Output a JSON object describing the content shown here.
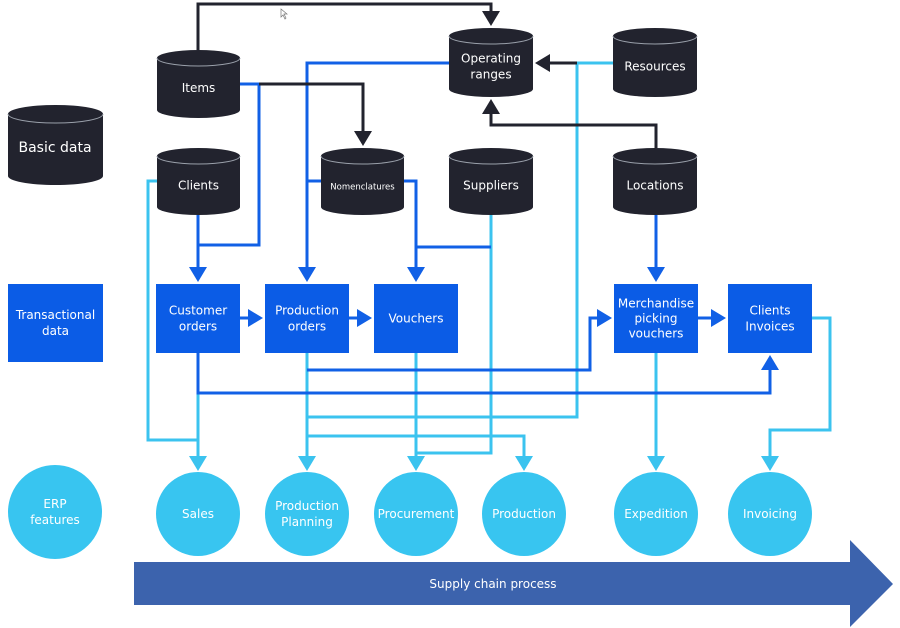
{
  "colors": {
    "cylinder": "#22232e",
    "transaction_box": "#0b5ce6",
    "feature_circle": "#38c5f0",
    "process_arrow": "#3c63ad",
    "dark_link": "#22232e",
    "blue_link": "#1160e6",
    "light_link": "#3bc3ef"
  },
  "rows": {
    "basic_data": "Basic data",
    "transactional_data": [
      "Transactional",
      "data"
    ],
    "erp_features": [
      "ERP",
      "features"
    ]
  },
  "basic_data": {
    "items": [
      "Items"
    ],
    "operating_ranges": [
      "Operating",
      "ranges"
    ],
    "resources": [
      "Resources"
    ],
    "clients": [
      "Clients"
    ],
    "nomenclatures": [
      "Nomenclatures"
    ],
    "suppliers": [
      "Suppliers"
    ],
    "locations": [
      "Locations"
    ]
  },
  "transactional_data": {
    "customer_orders": [
      "Customer",
      "orders"
    ],
    "production_orders": [
      "Production",
      "orders"
    ],
    "vouchers": [
      "Vouchers"
    ],
    "merchandise_picking_vouchers": [
      "Merchandise",
      "picking",
      "vouchers"
    ],
    "clients_invoices": [
      "Clients",
      "Invoices"
    ]
  },
  "erp_features": {
    "sales": [
      "Sales"
    ],
    "production_planning": [
      "Production",
      "Planning"
    ],
    "procurement": [
      "Procurement"
    ],
    "production": [
      "Production"
    ],
    "expedition": [
      "Expedition"
    ],
    "invoicing": [
      "Invoicing"
    ]
  },
  "process_arrow_label": "Supply chain process"
}
